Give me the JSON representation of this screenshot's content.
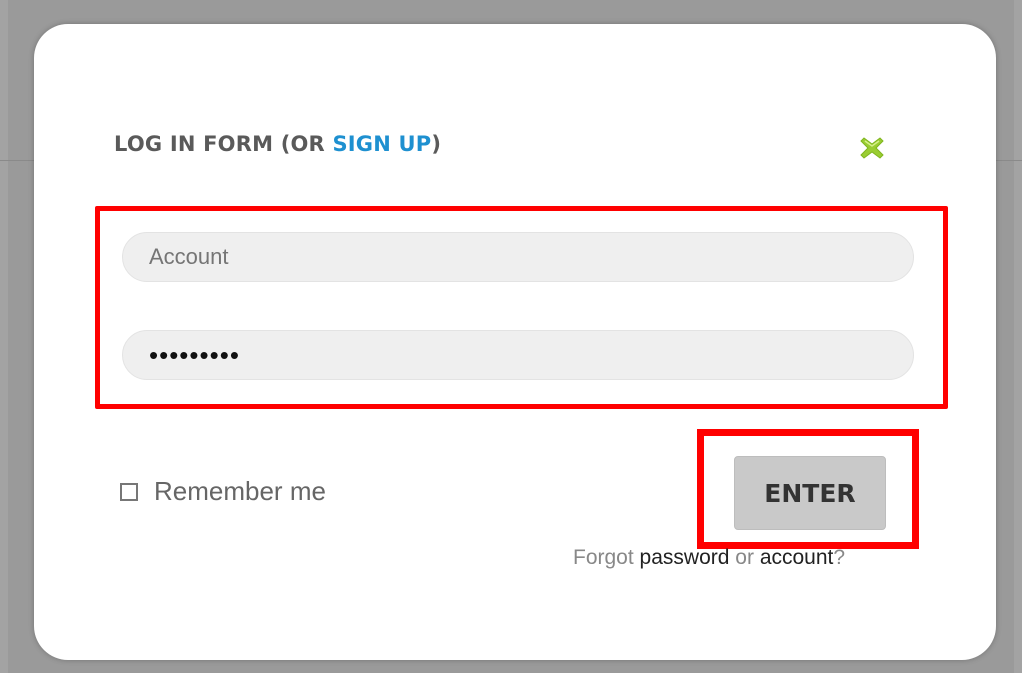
{
  "form": {
    "title_prefix": "LOG IN FORM (OR ",
    "signup_link": "SIGN UP",
    "title_suffix": ")",
    "close_icon": "close-x-icon",
    "account_placeholder": "Account",
    "password_masked": "•••••••••",
    "remember_label": "Remember me",
    "enter_label": "ENTER",
    "forgot_text": "Forgot",
    "password_link": "password",
    "or_text": "or",
    "account_link": "account",
    "question_mark": "?"
  },
  "colors": {
    "accent_link": "#1e90d0",
    "close_icon": "#9acd32",
    "highlight": "#ff0000",
    "backdrop": "#a3a3a3"
  }
}
